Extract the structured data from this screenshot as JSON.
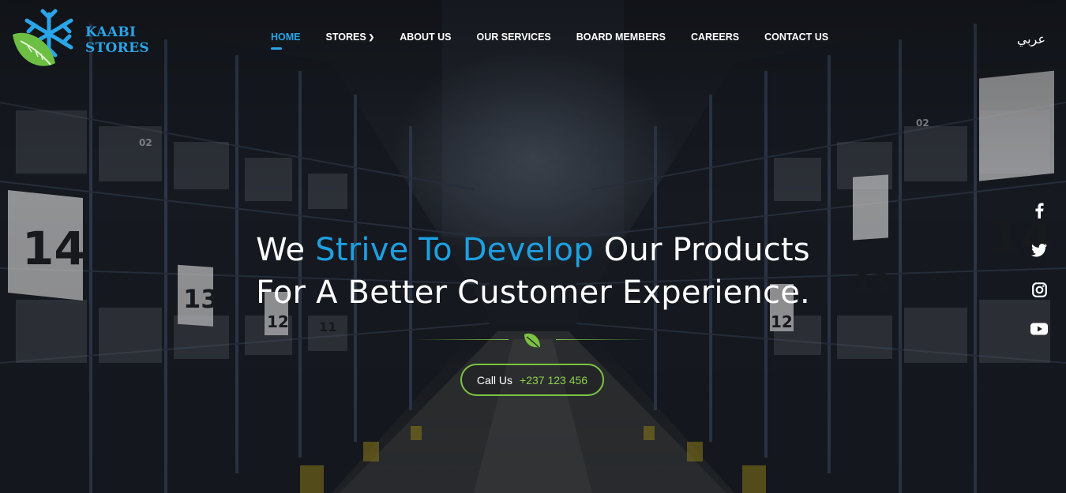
{
  "brand": {
    "name": "KAABI STORES",
    "color": "#29a5e8",
    "leaf_color": "#6cbf43"
  },
  "nav": {
    "items": [
      {
        "label": "HOME",
        "active": true
      },
      {
        "label": "STORES",
        "has_dropdown": true
      },
      {
        "label": "ABOUT US"
      },
      {
        "label": "OUR SERVICES"
      },
      {
        "label": "BOARD MEMBERS"
      },
      {
        "label": "CAREERS"
      },
      {
        "label": "CONTACT US"
      }
    ],
    "language_toggle": "عربي"
  },
  "hero": {
    "line1_part1": "We",
    "line1_accent": "Strive To Develop",
    "line1_part2": "Our Products",
    "line2": "For A Better Customer Experience.",
    "cta_label": "Call Us",
    "cta_phone": "+237 123 456"
  },
  "social": [
    "facebook-icon",
    "twitter-icon",
    "instagram-icon",
    "youtube-icon"
  ],
  "colors": {
    "accent": "#1da0e2",
    "green": "#7cc242"
  },
  "background": {
    "aisle_numbers": [
      "14",
      "13",
      "12",
      "11",
      "02",
      "14",
      "13",
      "12",
      "02"
    ]
  }
}
